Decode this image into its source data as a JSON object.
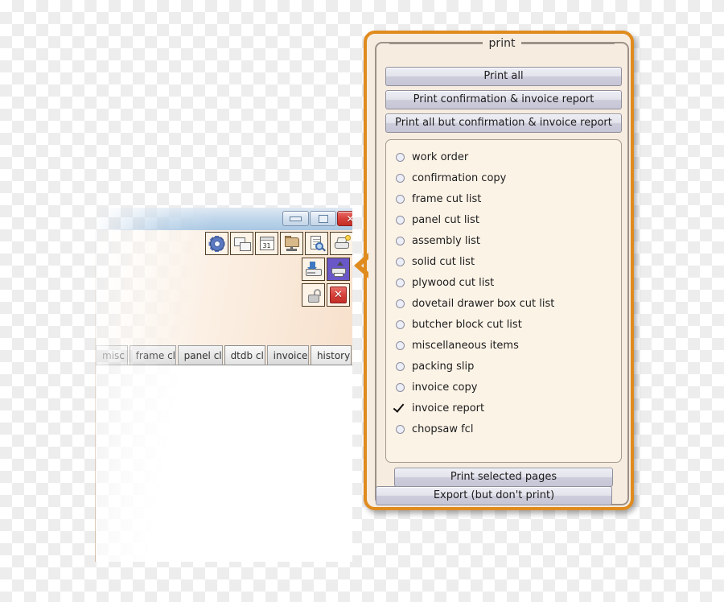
{
  "app_window": {
    "title_bar": {
      "minimize_label": "",
      "maximize_label": "",
      "close_label": "✕"
    },
    "toolbar_top": [
      {
        "name": "settings",
        "icon": "gear-icon",
        "tooltip": "settings"
      },
      {
        "name": "notes",
        "icon": "speech-bubbles-icon",
        "tooltip": "notes"
      },
      {
        "name": "calendar",
        "icon": "calendar-icon",
        "tooltip": "calendar",
        "day": "31"
      },
      {
        "name": "files",
        "icon": "folder-network-icon",
        "tooltip": "files"
      },
      {
        "name": "preview",
        "icon": "document-magnifier-icon",
        "tooltip": "preview"
      },
      {
        "name": "print-queue",
        "icon": "printer-badge-icon",
        "tooltip": "print queue"
      }
    ],
    "toolbar_mid": [
      {
        "name": "save",
        "icon": "save-to-disk-icon",
        "tooltip": "save"
      },
      {
        "name": "print",
        "icon": "printer-icon",
        "tooltip": "print",
        "selected": true
      }
    ],
    "toolbar_bottom": [
      {
        "name": "unlock",
        "icon": "open-padlock-icon",
        "tooltip": "unlock"
      },
      {
        "name": "close",
        "icon": "red-x-icon",
        "tooltip": "close",
        "label": "✕"
      }
    ],
    "tabs": [
      {
        "label": "misc",
        "active": false
      },
      {
        "label": "frame cl",
        "active": false
      },
      {
        "label": "panel cl",
        "active": false
      },
      {
        "label": "dtdb cl",
        "active": true
      },
      {
        "label": "invoice",
        "active": false
      },
      {
        "label": "history",
        "active": true
      }
    ]
  },
  "print_panel": {
    "legend": "print",
    "buttons": {
      "print_all": "Print all",
      "print_confirmation_invoice": "Print confirmation & invoice report",
      "print_all_but": "Print all but confirmation & invoice report",
      "print_selected": "Print selected pages",
      "export": "Export (but don't print)"
    },
    "options": [
      {
        "label": "work order",
        "checked": false
      },
      {
        "label": "confirmation copy",
        "checked": false
      },
      {
        "label": "frame cut list",
        "checked": false
      },
      {
        "label": "panel cut list",
        "checked": false
      },
      {
        "label": "assembly list",
        "checked": false
      },
      {
        "label": "solid cut list",
        "checked": false
      },
      {
        "label": "plywood cut list",
        "checked": false
      },
      {
        "label": "dovetail drawer box cut list",
        "checked": false
      },
      {
        "label": "butcher block cut list",
        "checked": false
      },
      {
        "label": "miscellaneous items",
        "checked": false
      },
      {
        "label": "packing slip",
        "checked": false
      },
      {
        "label": "invoice copy",
        "checked": false
      },
      {
        "label": "invoice report",
        "checked": true
      },
      {
        "label": "chopsaw fcl",
        "checked": false
      }
    ]
  },
  "colors": {
    "panel_border": "#e08b1e",
    "panel_background": "#f6ece0",
    "options_background": "#fcf3e7",
    "button_face": "#e3e3ec",
    "selected_tool": "#6a58c8",
    "close_red": "#d7413a",
    "titlebar_blue": "#bcd4ea"
  }
}
